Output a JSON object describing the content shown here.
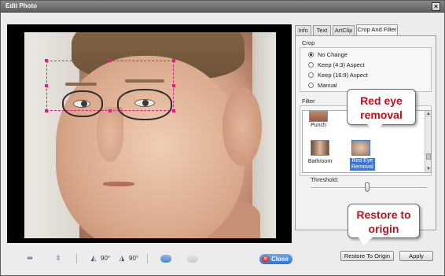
{
  "window": {
    "title": "Edit Photo",
    "close_glyph": "×"
  },
  "tabs": [
    {
      "label": "Info"
    },
    {
      "label": "Text"
    },
    {
      "label": "ArtClip"
    },
    {
      "label": "Crop And Filter"
    }
  ],
  "crop": {
    "label": "Crop",
    "options": [
      {
        "label": "No Change",
        "checked": true
      },
      {
        "label": "Keep (4:3) Aspect",
        "checked": false
      },
      {
        "label": "Keep (16:9) Aspect",
        "checked": false
      },
      {
        "label": "Manual",
        "checked": false
      }
    ]
  },
  "filter": {
    "label": "Filter",
    "thumbs": [
      {
        "label": "Punch",
        "icon": "punch-thumbnail"
      },
      {
        "label": "Bathroom",
        "icon": "bathroom-thumbnail"
      },
      {
        "label": "Red Eye Removal",
        "line1": "Red Eye",
        "line2": "Removal",
        "icon": "red-eye-thumbnail",
        "selected": true
      }
    ],
    "threshold_label": "Threshold:",
    "threshold_level": 0.5
  },
  "buttons": {
    "restore": "Restore To Origin",
    "apply": "Apply",
    "close": "Close"
  },
  "toolbar": {
    "rotate_left_value": "90°",
    "rotate_right_value": "90°",
    "icons": [
      "flip-horizontal-icon",
      "flip-vertical-icon",
      "rotate-left-icon",
      "rotate-right-icon",
      "previous-icon",
      "next-icon",
      "close-icon"
    ]
  },
  "callouts": {
    "red_eye": {
      "line1": "Red eye",
      "line2": "removal"
    },
    "restore": {
      "line1": "Restore to",
      "line2": "origin"
    }
  },
  "colors": {
    "selection": "#e21c8a",
    "callout_text": "#c0111b",
    "selected_item": "#3d77d1",
    "close_button": "#2f73cf"
  }
}
